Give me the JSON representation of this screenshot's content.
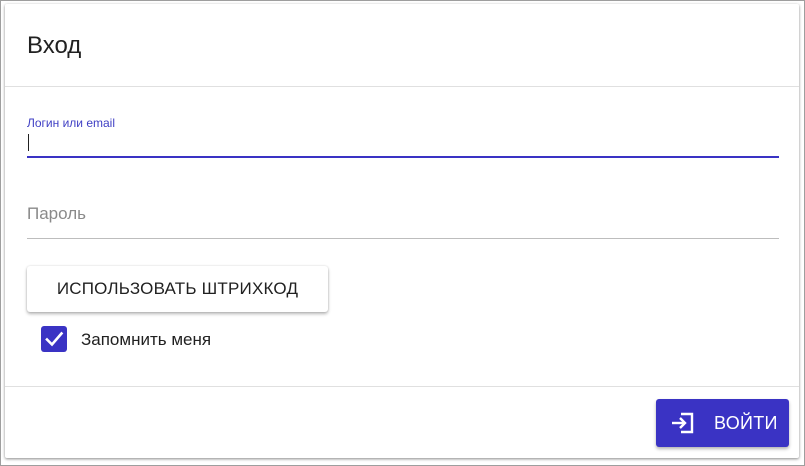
{
  "dialog": {
    "title": "Вход"
  },
  "login_field": {
    "label": "Логин или email",
    "value": ""
  },
  "password_field": {
    "placeholder": "Пароль",
    "value": ""
  },
  "barcode_button": {
    "label": "ИСПОЛЬЗОВАТЬ ШТРИХКОД"
  },
  "remember_me": {
    "label": "Запомнить меня",
    "checked": true
  },
  "submit_button": {
    "label": "ВОЙТИ",
    "icon": "login-icon"
  },
  "colors": {
    "accent": "#3a33c4",
    "label_accent": "#3f3fc4",
    "text": "#212121",
    "placeholder": "#8a8a8a"
  }
}
